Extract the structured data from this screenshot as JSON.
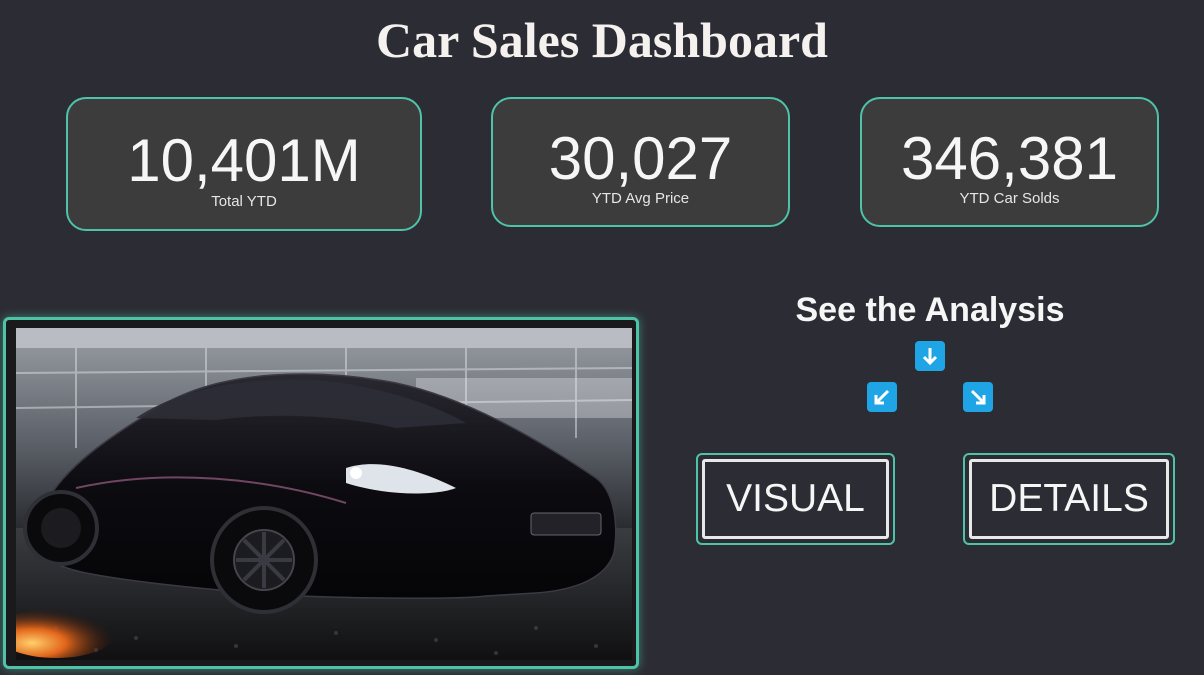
{
  "header": {
    "title": "Car Sales Dashboard"
  },
  "kpis": [
    {
      "value": "10,401M",
      "label": "Total YTD"
    },
    {
      "value": "30,027",
      "label": "YTD Avg Price"
    },
    {
      "value": "346,381",
      "label": "YTD Car Solds"
    }
  ],
  "photo": {
    "icon": "sports-car-photo"
  },
  "analysis": {
    "title": "See the Analysis",
    "arrows": [
      "arrow-down-icon",
      "arrow-down-left-icon",
      "arrow-down-right-icon"
    ],
    "visual_label": "VISUAL",
    "details_label": "DETAILS"
  },
  "colors": {
    "background": "#2c2c34",
    "card": "#3c3c3c",
    "accent": "#4fc3a8",
    "arrow": "#1fa5e6"
  }
}
